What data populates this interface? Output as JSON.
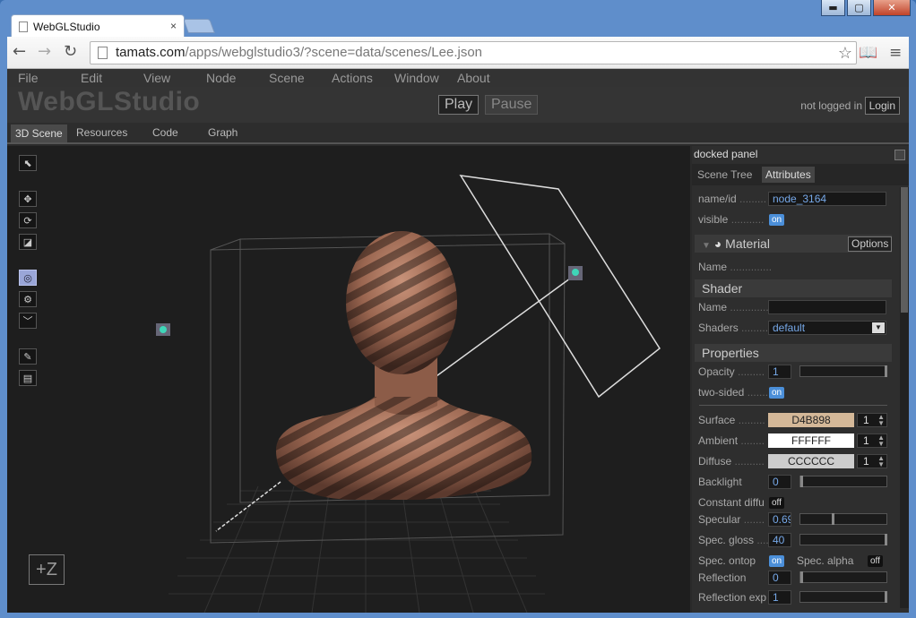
{
  "browser": {
    "tab_title": "WebGLStudio",
    "tab_close": "×",
    "url_host": "tamats.com",
    "url_path": "/apps/webglstudio3/?scene=data/scenes/Lee.json",
    "controls": {
      "minimize": "▬",
      "maximize": "▢",
      "close": "✕"
    }
  },
  "menu": [
    "File",
    "Edit",
    "View",
    "Node",
    "Scene",
    "Actions",
    "Window",
    "About"
  ],
  "app": {
    "logo": "WebGLStudio",
    "play": "Play",
    "pause": "Pause",
    "login_status": "not logged in",
    "login": "Login"
  },
  "main_tabs": [
    "3D Scene",
    "Resources",
    "Code",
    "Graph"
  ],
  "viewport": {
    "z_button": "+Z"
  },
  "panel": {
    "title": "docked panel",
    "tabs": [
      "Scene Tree",
      "Attributes"
    ],
    "name_label": "name/id",
    "name_value": "node_3164",
    "visible_label": "visible",
    "visible_value": "on",
    "material": {
      "title": "Material",
      "options": "Options",
      "name_label": "Name"
    },
    "shader": {
      "title": "Shader",
      "name_label": "Name",
      "shaders_label": "Shaders",
      "shaders_value": "default"
    },
    "properties": {
      "title": "Properties",
      "opacity_label": "Opacity",
      "opacity_value": "1",
      "two_sided_label": "two-sided",
      "two_sided_value": "on",
      "surface_label": "Surface",
      "surface_color": "D4B898",
      "surface_mult": "1",
      "ambient_label": "Ambient",
      "ambient_color": "FFFFFF",
      "ambient_mult": "1",
      "diffuse_label": "Diffuse",
      "diffuse_color": "CCCCCC",
      "diffuse_mult": "1",
      "backlight_label": "Backlight",
      "backlight_value": "0",
      "constant_label": "Constant diffu",
      "constant_value": "off",
      "specular_label": "Specular",
      "specular_value": "0.69",
      "gloss_label": "Spec. gloss",
      "gloss_value": "40",
      "ontop_label": "Spec. ontop",
      "ontop_value": "on",
      "alpha_label": "Spec. alpha",
      "alpha_value": "off",
      "reflection_label": "Reflection",
      "reflection_value": "0",
      "reflection_exp_label": "Reflection exp",
      "reflection_exp_value": "1"
    }
  }
}
